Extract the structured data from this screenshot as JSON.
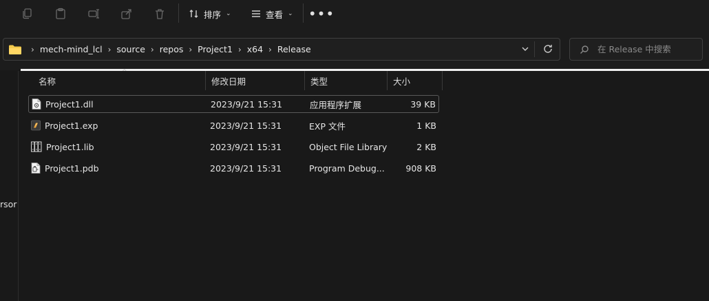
{
  "toolbar": {
    "sort_label": "排序",
    "view_label": "查看",
    "more_label": "•••"
  },
  "address": {
    "crumbs": [
      "mech-mind_lcl",
      "source",
      "repos",
      "Project1",
      "x64",
      "Release"
    ]
  },
  "search": {
    "placeholder": "在 Release 中搜索"
  },
  "nav": {
    "partial_text": "rsor"
  },
  "columns": {
    "name": "名称",
    "date": "修改日期",
    "type": "类型",
    "size": "大小"
  },
  "files": [
    {
      "name": "Project1.dll",
      "date": "2023/9/21 15:31",
      "type": "应用程序扩展",
      "size": "39 KB",
      "icon": "dll-file-icon"
    },
    {
      "name": "Project1.exp",
      "date": "2023/9/21 15:31",
      "type": "EXP 文件",
      "size": "1 KB",
      "icon": "exp-file-icon"
    },
    {
      "name": "Project1.lib",
      "date": "2023/9/21 15:31",
      "type": "Object File Library",
      "size": "2 KB",
      "icon": "lib-file-icon"
    },
    {
      "name": "Project1.pdb",
      "date": "2023/9/21 15:31",
      "type": "Program Debug...",
      "size": "908 KB",
      "icon": "pdb-file-icon"
    }
  ],
  "colors": {
    "background": "#191919",
    "toolbar": "#1c1c1c",
    "text": "#e6e6e6",
    "folder": "#f2c94c",
    "exp_icon": "#e8a33d"
  }
}
